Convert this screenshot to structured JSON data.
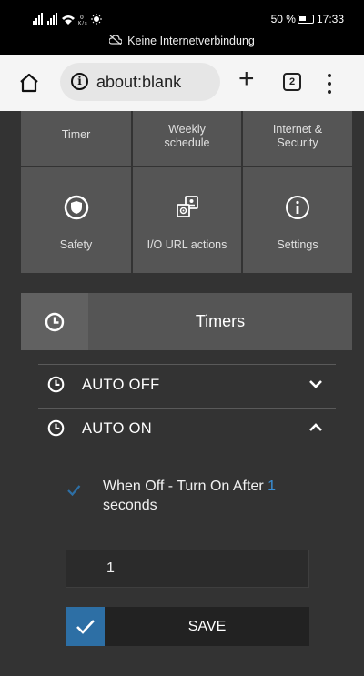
{
  "status_bar": {
    "signal": "∙ıl ∙ıl",
    "speed": "0 K/s",
    "battery": "50 %",
    "time": "17:33",
    "network": "Keine Internetverbindung"
  },
  "browser": {
    "url": "about:blank",
    "tab_count": "2"
  },
  "tiles": [
    {
      "label": "Timer",
      "icon": ""
    },
    {
      "label": "Weekly schedule",
      "icon": ""
    },
    {
      "label": "Internet & Security",
      "icon": ""
    },
    {
      "label": "Safety",
      "icon": "shield-icon"
    },
    {
      "label": "I/O URL actions",
      "icon": "io-url-icon"
    },
    {
      "label": "Settings",
      "icon": "info-icon"
    }
  ],
  "timers": {
    "title": "Timers",
    "items": [
      {
        "label": "AUTO OFF",
        "expanded": false
      },
      {
        "label": "AUTO ON",
        "expanded": true
      }
    ],
    "auto_on": {
      "checked": true,
      "text_prefix": "When Off - Turn On After",
      "value": "1",
      "text_suffix": "seconds",
      "input_value": "1",
      "save_label": "SAVE"
    }
  },
  "colors": {
    "accent": "#2d6fa5",
    "value_highlight": "#3a8fd6",
    "tile_bg": "#555555",
    "app_bg": "#333333"
  }
}
